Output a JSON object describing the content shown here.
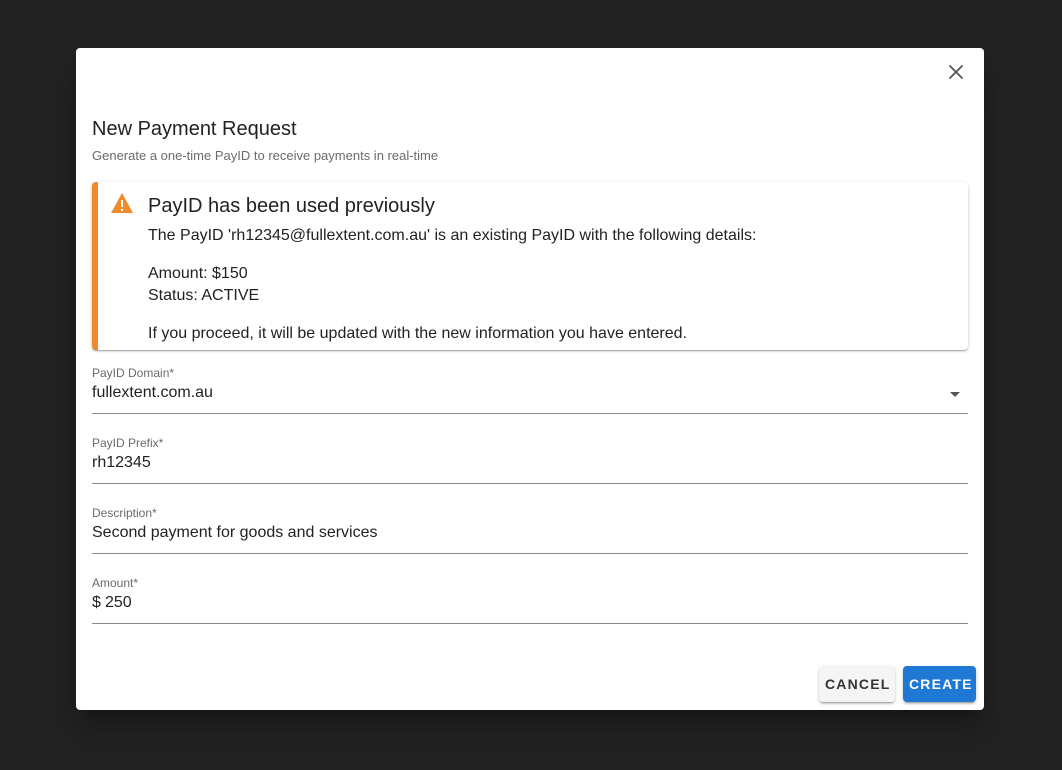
{
  "dialog": {
    "title": "New Payment Request",
    "subtitle": "Generate a one-time PayID to receive payments in real-time"
  },
  "alert": {
    "icon": "warning-icon",
    "title": "PayID has been used previously",
    "line1": "The PayID 'rh12345@fullextent.com.au' is an existing PayID with the following details:",
    "amount": "Amount: $150",
    "status": "Status: ACTIVE",
    "footer": "If you proceed, it will be updated with the new information you have entered.",
    "accent_color": "#f08b2c"
  },
  "fields": {
    "domain": {
      "label": "PayID Domain*",
      "value": "fullextent.com.au"
    },
    "prefix": {
      "label": "PayID Prefix*",
      "value": "rh12345"
    },
    "description": {
      "label": "Description*",
      "value": "Second payment for goods and services"
    },
    "amount": {
      "label": "Amount*",
      "prefix": "$",
      "value": "250"
    }
  },
  "buttons": {
    "cancel": "CANCEL",
    "create": "CREATE",
    "create_color": "#1e78d4"
  }
}
